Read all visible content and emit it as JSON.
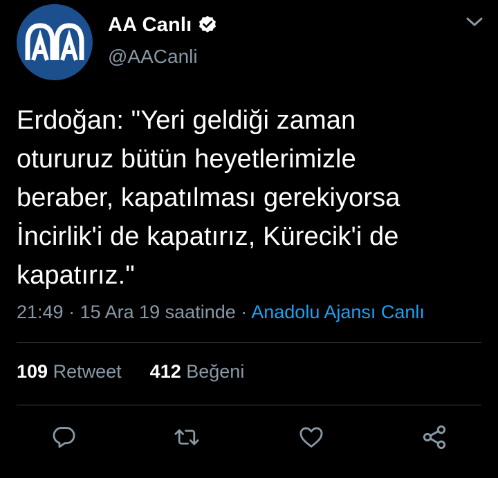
{
  "account": {
    "display_name": "AA Canlı",
    "handle": "@AACanli",
    "verified": true,
    "avatar_text": "AA",
    "avatar_color": "#1b4f8e"
  },
  "tweet": {
    "text_lines": [
      "Erdoğan: \"Yeri geldiği zaman",
      "otururuz bütün heyetlerimizle",
      "beraber, kapatılması gerekiyorsa",
      "İncirlik'i de kapatırız, Kürecik'i de",
      "kapatırız.\""
    ],
    "timestamp": "21:49 · 15 Ara 19 saatinde ·",
    "source": "Anadolu Ajansı Canlı"
  },
  "stats": {
    "retweet_count": "109",
    "retweet_label": "Retweet",
    "like_count": "412",
    "like_label": "Beğeni"
  },
  "actions": [
    {
      "icon": "reply-icon"
    },
    {
      "icon": "retweet-icon"
    },
    {
      "icon": "like-icon"
    },
    {
      "icon": "share-icon"
    }
  ],
  "colors": {
    "background": "#000000",
    "text_primary": "#ffffff",
    "text_secondary": "#8899a6",
    "link": "#1da1f2",
    "divider": "#38444d"
  }
}
